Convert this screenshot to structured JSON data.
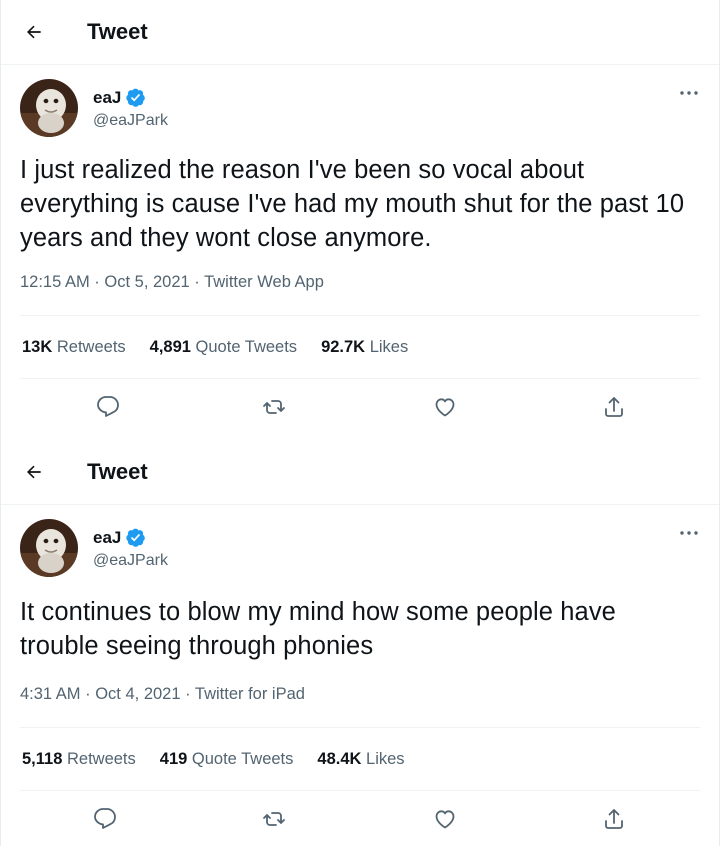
{
  "colors": {
    "text": "#0f1419",
    "muted": "#536471",
    "verified": "#1d9bf0",
    "divider": "#eff3f4"
  },
  "tweets": [
    {
      "header_title": "Tweet",
      "display_name": "eaJ",
      "handle": "@eaJPark",
      "text": "I just realized the reason I've been so vocal about everything is cause I've had my mouth shut for the past 10 years and they wont close anymore.",
      "time": "12:15 AM",
      "date": "Oct 5, 2021",
      "source": "Twitter Web App",
      "retweets_count": "13K",
      "retweets_label": "Retweets",
      "quotes_count": "4,891",
      "quotes_label": "Quote Tweets",
      "likes_count": "92.7K",
      "likes_label": "Likes"
    },
    {
      "header_title": "Tweet",
      "display_name": "eaJ",
      "handle": "@eaJPark",
      "text": "It continues to blow my mind how some people have trouble seeing through phonies",
      "time": "4:31 AM",
      "date": "Oct 4, 2021",
      "source": "Twitter for iPad",
      "retweets_count": "5,118",
      "retweets_label": "Retweets",
      "quotes_count": "419",
      "quotes_label": "Quote Tweets",
      "likes_count": "48.4K",
      "likes_label": "Likes"
    }
  ],
  "icons": [
    "back-arrow-icon",
    "verified-badge-icon",
    "more-options-icon",
    "reply-icon",
    "retweet-icon",
    "like-icon",
    "share-icon"
  ]
}
